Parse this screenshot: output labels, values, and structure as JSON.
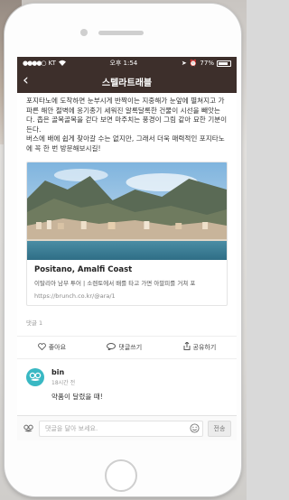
{
  "status_bar": {
    "carrier": "KT",
    "time": "오후 1:54",
    "battery": "77%"
  },
  "nav": {
    "back_icon": "chevron-left-icon",
    "title": "스텔라트래블"
  },
  "post": {
    "paragraph1": "포지타노에 도착하면 눈부시게 반짝이는 지중해가 눈앞에 펼쳐지고 가파른 해안 절벽에 옹기종기 세워진 알록달록한 건물이 시선을 빼앗는다. 좁은 골목골목을 걷다 보면 마주치는 풍경이 그림 같아 묘한 기분이 든다.",
    "paragraph2": "버스에 배에 쉽게 찾아갈 수는 없지만, 그래서 더욱 매력적인 포지타노에 꼭 한 번 방문해보시길!"
  },
  "link_card": {
    "title": "Positano, Amalfi Coast",
    "description": "이탈리아 남부 투어 | 소렌토에서 배를 타고 가면 아말피를 거쳐 포",
    "url": "https://brunch.co.kr/@ara/1"
  },
  "comments_count_label": "댓글 1",
  "actions": {
    "like": "좋아요",
    "comment": "댓글쓰기",
    "share": "공유하기"
  },
  "comment": {
    "author": "bin",
    "time": "18시간 전",
    "text": "약품이 달렸을 때!"
  },
  "input": {
    "placeholder": "댓글을 달아 보세요.",
    "send": "전송"
  },
  "colors": {
    "header_bg": "#3d2f2b",
    "avatar": "#39b8c3"
  }
}
